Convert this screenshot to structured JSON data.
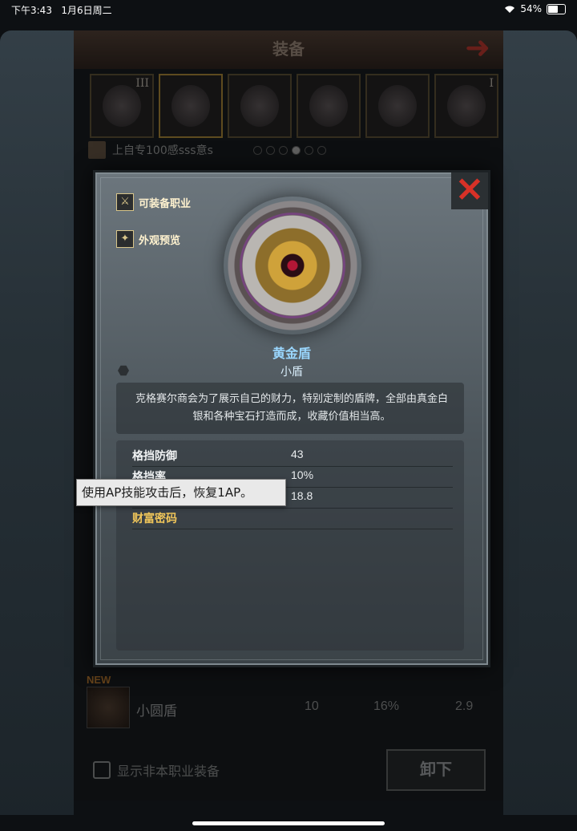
{
  "status": {
    "time": "下午3:43",
    "date": "1月6日周二",
    "battery": "54%"
  },
  "header": {
    "title": "装备"
  },
  "slots": [
    {
      "roman": "III"
    },
    {
      "roman": ""
    },
    {
      "roman": ""
    },
    {
      "roman": ""
    },
    {
      "roman": ""
    },
    {
      "roman": "I"
    }
  ],
  "character": {
    "name": "上自专100感sss意s"
  },
  "list": {
    "row1": {
      "new": "NEW",
      "name": "小圆盾",
      "stat1": "10",
      "stat2": "16%",
      "stat3": "2.9"
    }
  },
  "footer": {
    "checkbox_label": "显示非本职业装备",
    "unequip_label": "卸下"
  },
  "popup": {
    "close_icon": "✕",
    "features": [
      {
        "label": "可装备职业",
        "icon": "class-icon"
      },
      {
        "label": "外观预览",
        "icon": "appearance-icon"
      }
    ],
    "item_name": "黄金盾",
    "item_type": "小盾",
    "description": "克格赛尔商会为了展示自己的财力，特别定制的盾牌，全部由真金白银和各种宝石打造而成，收藏价值相当高。",
    "stats": [
      {
        "label": "格挡防御",
        "value": "43"
      },
      {
        "label": "格挡率",
        "value": "10%"
      },
      {
        "label": "",
        "value": "18.8"
      },
      {
        "label": "财富密码",
        "value": ""
      }
    ]
  },
  "tooltip": {
    "text": "使用AP技能攻击后，恢复1AP。"
  }
}
